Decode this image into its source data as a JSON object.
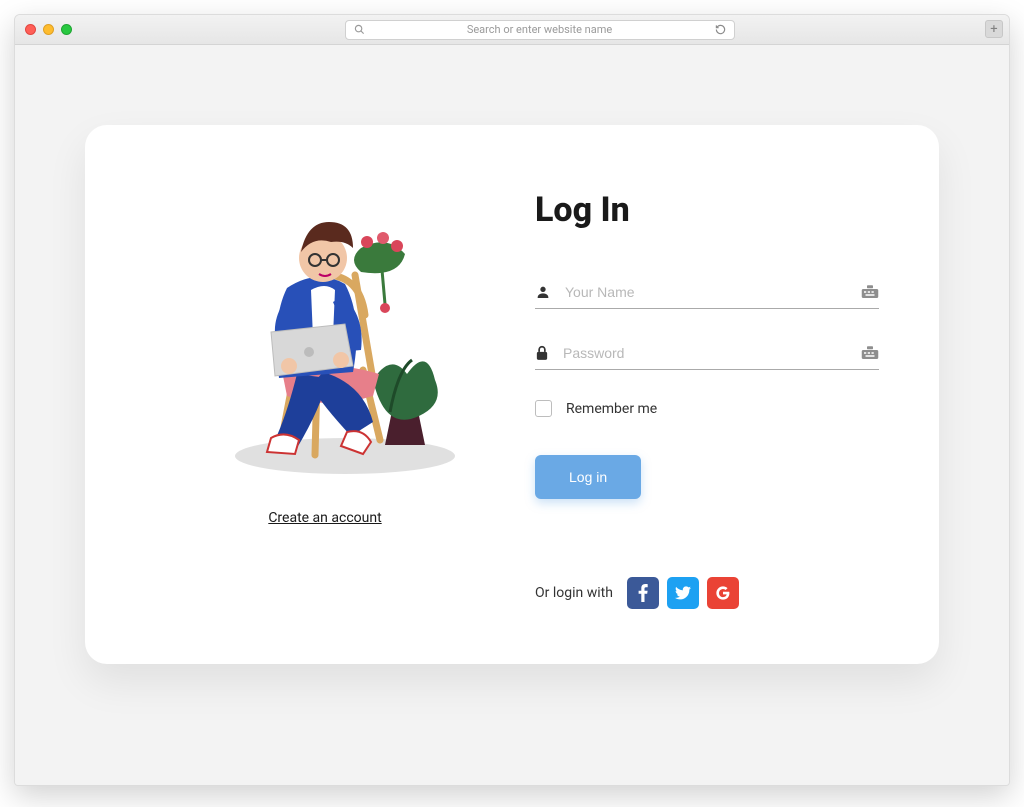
{
  "browser": {
    "url_placeholder": "Search or enter website name"
  },
  "card": {
    "title": "Log In",
    "username_placeholder": "Your Name",
    "password_placeholder": "Password",
    "remember_label": "Remember me",
    "login_button": "Log in",
    "create_account": "Create an account",
    "social_label": "Or login with"
  }
}
